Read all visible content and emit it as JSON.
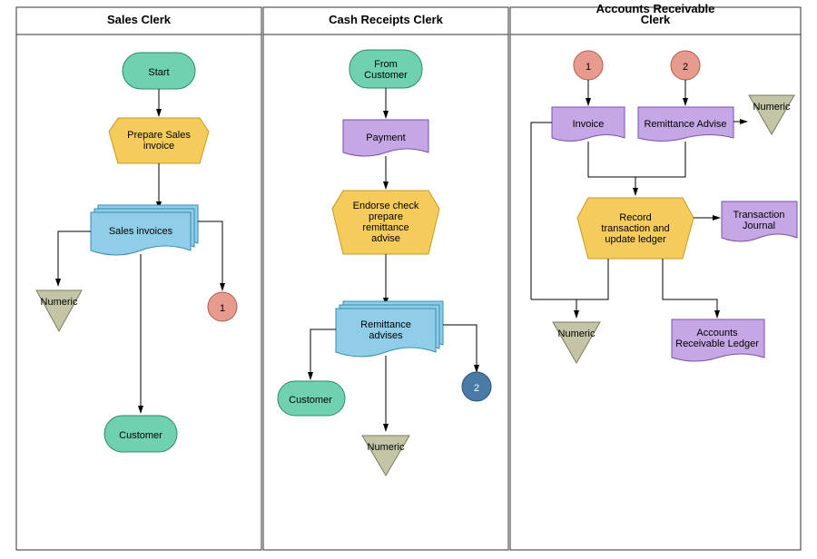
{
  "lanes": [
    {
      "title": "Sales Clerk"
    },
    {
      "title": "Cash Receipts Clerk"
    },
    {
      "title": "Accounts Receivable\nClerk"
    }
  ],
  "nodes": {
    "start": "Start",
    "prepare_sales_invoice": "Prepare Sales\ninvoice",
    "sales_invoices": "Sales invoices",
    "numeric1": "Numeric",
    "connector1": "1",
    "customer1": "Customer",
    "from_customer": "From\nCustomer",
    "payment": "Payment",
    "endorse_check": "Endorse check\nprepare\nremittance\nadvise",
    "remittance_advises": "Remittance\nadvises",
    "customer2": "Customer",
    "numeric2": "Numeric",
    "connector2": "2",
    "connector1b": "1",
    "connector2b": "2",
    "invoice": "Invoice",
    "remittance_advise": "Remittance Advise",
    "numeric3": "Numeric",
    "record_transaction": "Record\ntransaction and\nupdate ledger",
    "transaction_journal": "Transaction\nJournal",
    "numeric4": "Numeric",
    "ar_ledger": "Accounts\nReceivable Ledger"
  },
  "chart_data": {
    "type": "flowchart",
    "lanes": [
      "Sales Clerk",
      "Cash Receipts Clerk",
      "Accounts Receivable Clerk"
    ],
    "shapes": [
      {
        "id": "start",
        "lane": 0,
        "type": "terminator",
        "label": "Start",
        "color": "green"
      },
      {
        "id": "prepare_sales_invoice",
        "lane": 0,
        "type": "process_trapezoid",
        "label": "Prepare Sales invoice",
        "color": "yellow"
      },
      {
        "id": "sales_invoices",
        "lane": 0,
        "type": "multidoc",
        "label": "Sales invoices",
        "color": "blue"
      },
      {
        "id": "numeric1",
        "lane": 0,
        "type": "storage_triangle",
        "label": "Numeric",
        "color": "gray"
      },
      {
        "id": "connector1",
        "lane": 0,
        "type": "connector_circle",
        "label": "1",
        "color": "pink"
      },
      {
        "id": "customer1",
        "lane": 0,
        "type": "terminator",
        "label": "Customer",
        "color": "green"
      },
      {
        "id": "from_customer",
        "lane": 1,
        "type": "terminator",
        "label": "From Customer",
        "color": "green"
      },
      {
        "id": "payment",
        "lane": 1,
        "type": "document",
        "label": "Payment",
        "color": "purple"
      },
      {
        "id": "endorse_check",
        "lane": 1,
        "type": "process_trapezoid",
        "label": "Endorse check prepare remittance advise",
        "color": "yellow"
      },
      {
        "id": "remittance_advises",
        "lane": 1,
        "type": "multidoc",
        "label": "Remittance advises",
        "color": "blue"
      },
      {
        "id": "customer2",
        "lane": 1,
        "type": "terminator",
        "label": "Customer",
        "color": "green"
      },
      {
        "id": "numeric2",
        "lane": 1,
        "type": "storage_triangle",
        "label": "Numeric",
        "color": "gray"
      },
      {
        "id": "connector2",
        "lane": 1,
        "type": "connector_circle",
        "label": "2",
        "color": "darkblue"
      },
      {
        "id": "connector1b",
        "lane": 2,
        "type": "connector_circle",
        "label": "1",
        "color": "pink"
      },
      {
        "id": "connector2b",
        "lane": 2,
        "type": "connector_circle",
        "label": "2",
        "color": "pink"
      },
      {
        "id": "invoice",
        "lane": 2,
        "type": "document",
        "label": "Invoice",
        "color": "purple"
      },
      {
        "id": "remittance_advise",
        "lane": 2,
        "type": "document",
        "label": "Remittance Advise",
        "color": "purple"
      },
      {
        "id": "numeric3",
        "lane": 2,
        "type": "storage_triangle",
        "label": "Numeric",
        "color": "gray"
      },
      {
        "id": "record_transaction",
        "lane": 2,
        "type": "process_trapezoid",
        "label": "Record transaction and update ledger",
        "color": "yellow"
      },
      {
        "id": "transaction_journal",
        "lane": 2,
        "type": "document",
        "label": "Transaction Journal",
        "color": "purple"
      },
      {
        "id": "numeric4",
        "lane": 2,
        "type": "storage_triangle",
        "label": "Numeric",
        "color": "gray"
      },
      {
        "id": "ar_ledger",
        "lane": 2,
        "type": "document",
        "label": "Accounts Receivable Ledger",
        "color": "purple"
      }
    ],
    "edges": [
      [
        "start",
        "prepare_sales_invoice"
      ],
      [
        "prepare_sales_invoice",
        "sales_invoices"
      ],
      [
        "sales_invoices",
        "numeric1"
      ],
      [
        "sales_invoices",
        "connector1"
      ],
      [
        "sales_invoices",
        "customer1"
      ],
      [
        "from_customer",
        "payment"
      ],
      [
        "payment",
        "endorse_check"
      ],
      [
        "endorse_check",
        "remittance_advises"
      ],
      [
        "remittance_advises",
        "customer2"
      ],
      [
        "remittance_advises",
        "numeric2"
      ],
      [
        "remittance_advises",
        "connector2"
      ],
      [
        "connector1b",
        "invoice"
      ],
      [
        "connector2b",
        "remittance_advise"
      ],
      [
        "remittance_advise",
        "numeric3"
      ],
      [
        "invoice",
        "record_transaction"
      ],
      [
        "remittance_advise",
        "record_transaction"
      ],
      [
        "record_transaction",
        "transaction_journal"
      ],
      [
        "record_transaction",
        "numeric4"
      ],
      [
        "record_transaction",
        "ar_ledger"
      ]
    ]
  }
}
